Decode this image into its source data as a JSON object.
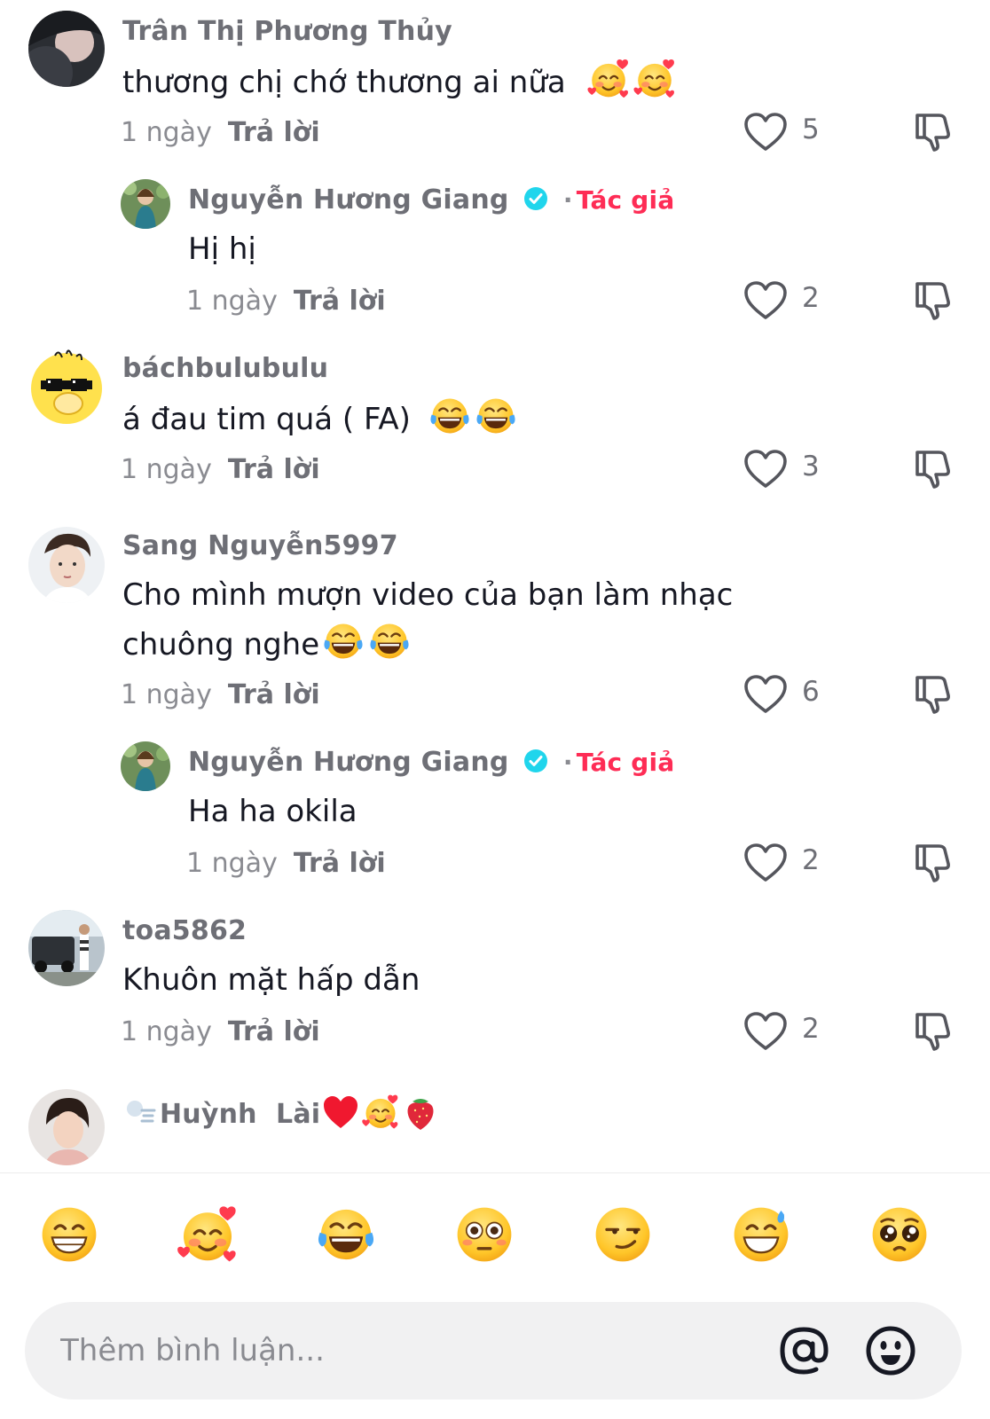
{
  "comments": [
    {
      "username": "Trân Thị Phương Thủy",
      "text": "thương chị chớ thương ai nữa",
      "text_emojis": [
        "smiling-face-with-hearts",
        "smiling-face-with-hearts"
      ],
      "time": "1 ngày",
      "reply_label": "Trả lời",
      "likes": "5",
      "replies": [
        {
          "username": "Nguyễn Hương Giang",
          "verified": true,
          "author_separator": "·",
          "author_tag": "Tác giả",
          "text": "Hị hị",
          "time": "1 ngày",
          "reply_label": "Trả lời",
          "likes": "2"
        }
      ]
    },
    {
      "username": "báchbulubulu",
      "text": "á đau tim quá ( FA)",
      "text_emojis": [
        "face-with-tears-of-joy",
        "face-with-tears-of-joy"
      ],
      "time": "1 ngày",
      "reply_label": "Trả lời",
      "likes": "3"
    },
    {
      "username": "Sang Nguyễn5997",
      "text_line1": "Cho mình mượn video của bạn làm nhạc",
      "text_line2": "chuông nghe",
      "text_emojis": [
        "face-with-tears-of-joy",
        "face-with-tears-of-joy"
      ],
      "time": "1 ngày",
      "reply_label": "Trả lời",
      "likes": "6",
      "replies": [
        {
          "username": "Nguyễn Hương Giang",
          "verified": true,
          "author_separator": "·",
          "author_tag": "Tác giả",
          "text": "Ha ha okila",
          "time": "1 ngày",
          "reply_label": "Trả lời",
          "likes": "2"
        }
      ]
    },
    {
      "username": "toa5862",
      "text": "Khuôn mặt hấp dẫn",
      "time": "1 ngày",
      "reply_label": "Trả lời",
      "likes": "2"
    },
    {
      "username": "Huỳnh  Lài",
      "username_emojis": [
        "wind-face",
        "red-heart",
        "smiling-face-with-hearts",
        "strawberry"
      ]
    }
  ],
  "quick_emojis": [
    "grinning-face",
    "smiling-face-with-hearts",
    "face-with-tears-of-joy",
    "flushed-face",
    "smirking-face",
    "grinning-sweat-face",
    "pleading-face"
  ],
  "input": {
    "placeholder": "Thêm bình luận..."
  },
  "input_icons": [
    "at-mention-icon",
    "emoji-picker-icon"
  ],
  "colors": {
    "author_tag": "#fe2c55",
    "verified": "#20d5ec",
    "muted_text": "#8a8b91",
    "emoji_yellow": "#ffcc33"
  }
}
